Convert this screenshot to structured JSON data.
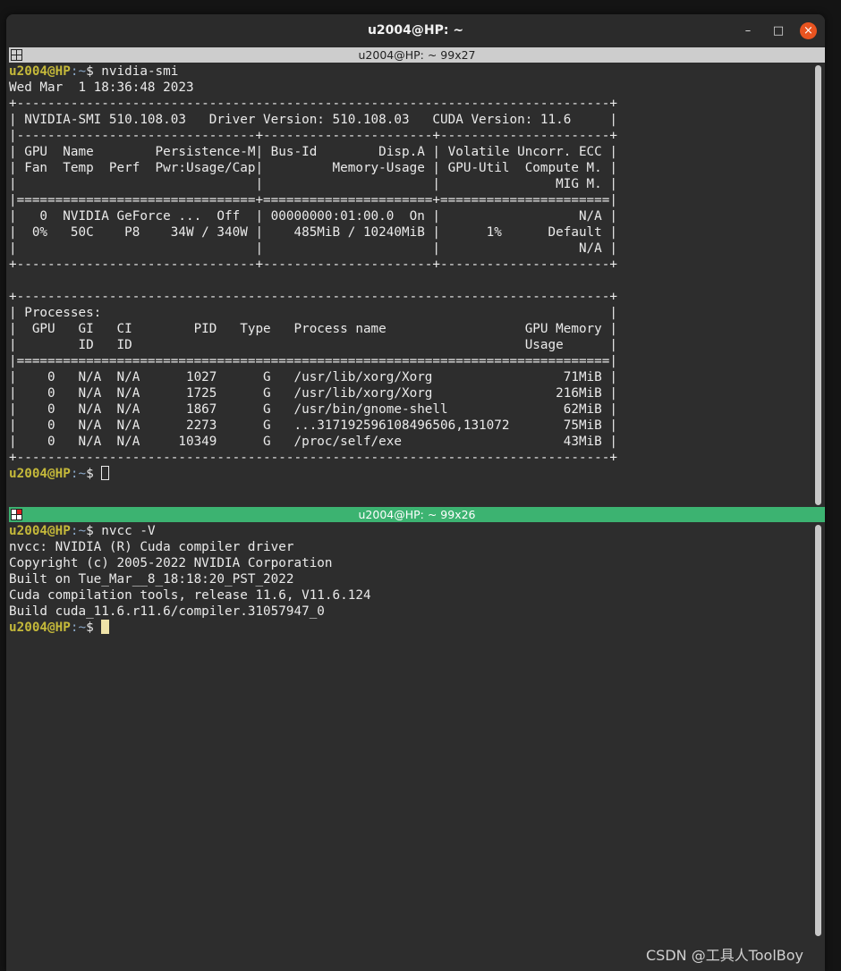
{
  "window": {
    "title": "u2004@HP: ~",
    "btn_min": "–",
    "btn_max": "□",
    "btn_close": "×"
  },
  "pane1": {
    "header": "u2004@HP: ~ 99x27",
    "lines": [
      {
        "user": "u2004@HP",
        "path": ":~",
        "rest": "$ nvidia-smi"
      },
      {
        "text": "Wed Mar  1 18:36:48 2023"
      },
      {
        "text": "+-----------------------------------------------------------------------------+"
      },
      {
        "text": "| NVIDIA-SMI 510.108.03   Driver Version: 510.108.03   CUDA Version: 11.6     |"
      },
      {
        "text": "|-------------------------------+----------------------+----------------------+"
      },
      {
        "text": "| GPU  Name        Persistence-M| Bus-Id        Disp.A | Volatile Uncorr. ECC |"
      },
      {
        "text": "| Fan  Temp  Perf  Pwr:Usage/Cap|         Memory-Usage | GPU-Util  Compute M. |"
      },
      {
        "text": "|                               |                      |               MIG M. |"
      },
      {
        "text": "|===============================+======================+======================|"
      },
      {
        "text": "|   0  NVIDIA GeForce ...  Off  | 00000000:01:00.0  On |                  N/A |"
      },
      {
        "text": "|  0%   50C    P8    34W / 340W |    485MiB / 10240MiB |      1%      Default |"
      },
      {
        "text": "|                               |                      |                  N/A |"
      },
      {
        "text": "+-------------------------------+----------------------+----------------------+"
      },
      {
        "text": ""
      },
      {
        "text": "+-----------------------------------------------------------------------------+"
      },
      {
        "text": "| Processes:                                                                  |"
      },
      {
        "text": "|  GPU   GI   CI        PID   Type   Process name                  GPU Memory |"
      },
      {
        "text": "|        ID   ID                                                   Usage      |"
      },
      {
        "text": "|=============================================================================|"
      },
      {
        "text": "|    0   N/A  N/A      1027      G   /usr/lib/xorg/Xorg                 71MiB |"
      },
      {
        "text": "|    0   N/A  N/A      1725      G   /usr/lib/xorg/Xorg                216MiB |"
      },
      {
        "text": "|    0   N/A  N/A      1867      G   /usr/bin/gnome-shell               62MiB |"
      },
      {
        "text": "|    0   N/A  N/A      2273      G   ...317192596108496506,131072       75MiB |"
      },
      {
        "text": "|    0   N/A  N/A     10349      G   /proc/self/exe                     43MiB |"
      },
      {
        "text": "+-----------------------------------------------------------------------------+"
      },
      {
        "user": "u2004@HP",
        "path": ":~",
        "rest": "$ ",
        "cursor": "hollow"
      }
    ]
  },
  "pane2": {
    "header": "u2004@HP: ~ 99x26",
    "lines": [
      {
        "user": "u2004@HP",
        "path": ":~",
        "rest": "$ nvcc -V"
      },
      {
        "text": "nvcc: NVIDIA (R) Cuda compiler driver"
      },
      {
        "text": "Copyright (c) 2005-2022 NVIDIA Corporation"
      },
      {
        "text": "Built on Tue_Mar__8_18:18:20_PST_2022"
      },
      {
        "text": "Cuda compilation tools, release 11.6, V11.6.124"
      },
      {
        "text": "Build cuda_11.6.r11.6/compiler.31057947_0"
      },
      {
        "user": "u2004@HP",
        "path": ":~",
        "rest": "$ ",
        "cursor": "solid"
      }
    ]
  },
  "watermark": "CSDN @工具人ToolBoy"
}
